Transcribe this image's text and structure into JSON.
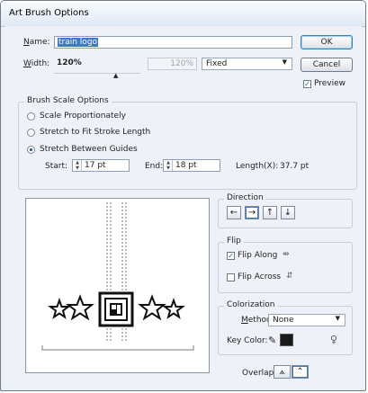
{
  "window": {
    "title": "Art Brush Options"
  },
  "name_field": {
    "label": "Name:",
    "value": "train logo"
  },
  "width_field": {
    "label": "Width:",
    "value": "120%",
    "secondary_value": "120%",
    "mode": "Fixed"
  },
  "buttons": {
    "ok": "OK",
    "cancel": "Cancel"
  },
  "preview_toggle": {
    "label": "Preview",
    "checked": true
  },
  "brush_scale": {
    "title": "Brush Scale Options",
    "options": [
      "Scale Proportionately",
      "Stretch to Fit Stroke Length",
      "Stretch Between Guides"
    ],
    "selected": "Stretch Between Guides",
    "start_label": "Start:",
    "start_value": "17 pt",
    "end_label": "End:",
    "end_value": "18 pt",
    "length_label": "Length(X):",
    "length_value": "37.7 pt"
  },
  "direction": {
    "title": "Direction",
    "buttons": [
      "left-arrow",
      "right-arrow",
      "up-arrow",
      "down-arrow"
    ],
    "selected": "right-arrow"
  },
  "flip": {
    "title": "Flip",
    "flip_along": {
      "label": "Flip Along",
      "checked": true
    },
    "flip_across": {
      "label": "Flip Across",
      "checked": false
    }
  },
  "colorization": {
    "title": "Colorization",
    "method_label": "Method:",
    "method_value": "None",
    "key_color_label": "Key Color:",
    "key_color": "#1a1a1a"
  },
  "overlap": {
    "label": "Overlap:"
  }
}
